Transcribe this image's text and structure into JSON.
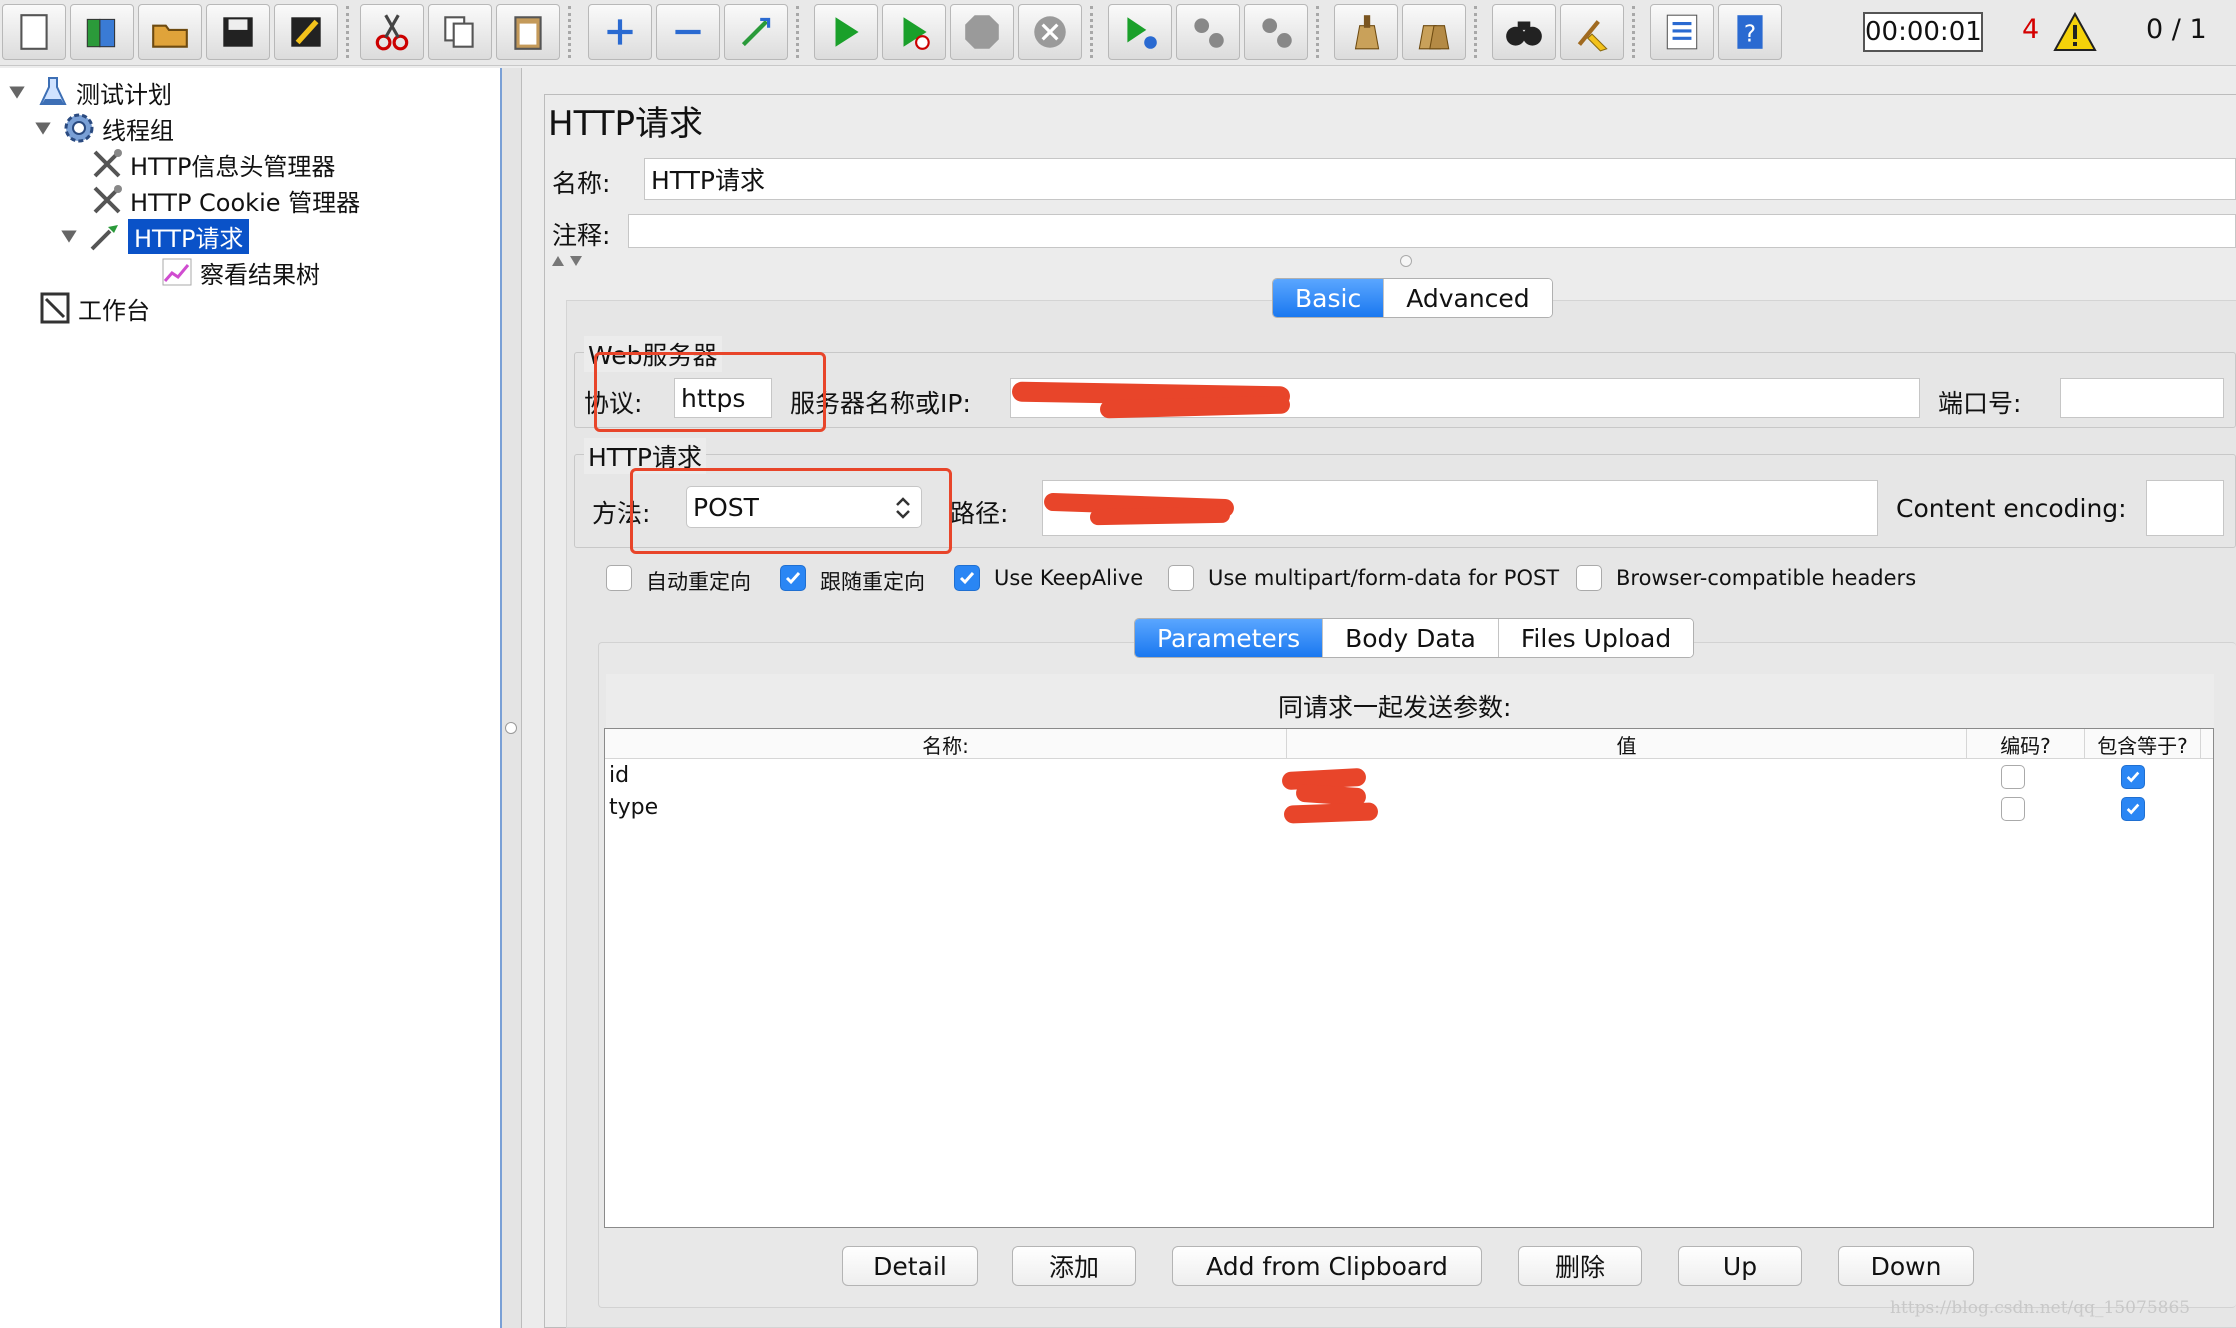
{
  "toolbar": {
    "buttons": [
      "new-icon",
      "templates-icon",
      "open-icon",
      "save-icon",
      "save-as-icon",
      "cut-icon",
      "copy-icon",
      "paste-icon",
      "expand-icon",
      "collapse-icon",
      "toggle-icon",
      "start-icon",
      "start-no-timers-icon",
      "stop-icon",
      "shutdown-icon",
      "remote-start-icon",
      "remote-stop-icon",
      "remote-shutdown-icon",
      "clear-icon",
      "clear-all-icon",
      "search-icon",
      "reset-search-icon",
      "function-helper-icon",
      "help-icon"
    ],
    "timer": "00:00:01",
    "error_count": "4",
    "threads": "0 / 1"
  },
  "tree": {
    "items": [
      {
        "label": "测试计划"
      },
      {
        "label": "线程组"
      },
      {
        "label": "HTTP信息头管理器"
      },
      {
        "label": "HTTP Cookie 管理器"
      },
      {
        "label": "HTTP请求"
      },
      {
        "label": "察看结果树"
      },
      {
        "label": "工作台"
      }
    ]
  },
  "panel": {
    "title": "HTTP请求",
    "name_label": "名称:",
    "name_value": "HTTP请求",
    "comment_label": "注释:",
    "comment_value": "",
    "tabs": [
      "Basic",
      "Advanced"
    ],
    "web_server": {
      "legend": "Web服务器",
      "protocol_label": "协议:",
      "protocol_value": "https",
      "server_label": "服务器名称或IP:",
      "port_label": "端口号:",
      "port_value": ""
    },
    "http_request": {
      "legend": "HTTP请求",
      "method_label": "方法:",
      "method_value": "POST",
      "path_label": "路径:",
      "encoding_label": "Content encoding:",
      "encoding_value": ""
    },
    "checkboxes": [
      {
        "label": "自动重定向",
        "checked": false
      },
      {
        "label": "跟随重定向",
        "checked": true
      },
      {
        "label": "Use KeepAlive",
        "checked": true
      },
      {
        "label": "Use multipart/form-data for POST",
        "checked": false
      },
      {
        "label": "Browser-compatible headers",
        "checked": false
      }
    ],
    "subtabs": [
      "Parameters",
      "Body Data",
      "Files Upload"
    ],
    "params_title": "同请求一起发送参数:",
    "table": {
      "headers": [
        "名称:",
        "值",
        "编码?",
        "包含等于?"
      ],
      "rows": [
        {
          "name": "id",
          "encode": false,
          "include_equals": true
        },
        {
          "name": "type",
          "encode": false,
          "include_equals": true
        }
      ]
    },
    "buttons": [
      "Detail",
      "添加",
      "Add from Clipboard",
      "删除",
      "Up",
      "Down"
    ]
  },
  "watermark": "https://blog.csdn.net/qq_15075865",
  "colors": {
    "accent": "#1a78f0",
    "annotation": "#e8452a",
    "selection": "#0a52c8"
  }
}
